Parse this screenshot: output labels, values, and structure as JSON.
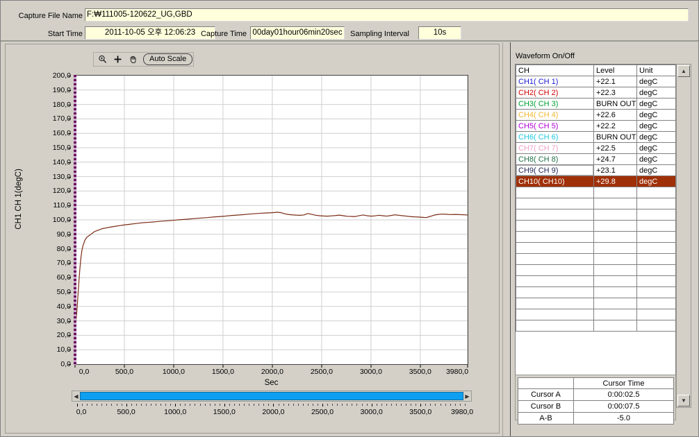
{
  "header": {
    "file_label": "Capture File Name",
    "file_value": "F:₩111005-120622_UG,GBD",
    "start_label": "Start Time",
    "start_value": "2011-10-05 오후 12:06:23",
    "capture_label": "Capture Time",
    "capture_value": "00day01hour06min20sec",
    "sampling_label": "Sampling Interval",
    "sampling_value": "10s"
  },
  "toolbar": {
    "zoom_icon": "magnifier-icon",
    "crosshair_icon": "crosshair-icon",
    "pan_icon": "hand-icon",
    "autoscale_label": "Auto Scale"
  },
  "right": {
    "waveform_title": "Waveform On/Off",
    "columns": [
      "CH",
      "Level",
      "Unit"
    ],
    "channels": [
      {
        "name": "CH1( CH 1)",
        "level": "+22.1",
        "unit": "degC",
        "color": "#1a1ad0",
        "selected": false,
        "focus": false
      },
      {
        "name": "CH2( CH 2)",
        "level": "+22.3",
        "unit": "degC",
        "color": "#d00000",
        "selected": false,
        "focus": false
      },
      {
        "name": "CH3( CH 3)",
        "level": "BURN OUT",
        "unit": "degC",
        "color": "#00a030",
        "selected": false,
        "focus": false
      },
      {
        "name": "CH4( CH 4)",
        "level": "+22.6",
        "unit": "degC",
        "color": "#f0b830",
        "selected": false,
        "focus": false
      },
      {
        "name": "CH5( CH 5)",
        "level": "+22.2",
        "unit": "degC",
        "color": "#b000d8",
        "selected": false,
        "focus": false
      },
      {
        "name": "CH6( CH 6)",
        "level": "BURN OUT",
        "unit": "degC",
        "color": "#20c8e0",
        "selected": false,
        "focus": false
      },
      {
        "name": "CH7( CH 7)",
        "level": "+22.5",
        "unit": "degC",
        "color": "#f0a0c8",
        "selected": false,
        "focus": false
      },
      {
        "name": "CH8( CH 8)",
        "level": "+24.7",
        "unit": "degC",
        "color": "#207048",
        "selected": false,
        "focus": false
      },
      {
        "name": "CH9( CH 9)",
        "level": "+23.1",
        "unit": "degC",
        "color": "#202858",
        "selected": false,
        "focus": true
      },
      {
        "name": "CH10( CH10)",
        "level": "+29.8",
        "unit": "degC",
        "color": "#ffffff",
        "selected": true,
        "focus": false
      }
    ],
    "empty_row_count": 13,
    "selection_color": "#a03008",
    "cursor": {
      "header": [
        "",
        "Cursor Time"
      ],
      "rows": [
        {
          "label": "Cursor A",
          "value": "0:00:02.5"
        },
        {
          "label": "Cursor B",
          "value": "0:00:07.5"
        },
        {
          "label": "A-B",
          "value": "-5.0"
        }
      ]
    }
  },
  "chart_data": {
    "type": "line",
    "title": "",
    "xlabel": "Sec",
    "ylabel": "CH1  CH 1(degC)",
    "xlim": [
      0,
      3980
    ],
    "ylim": [
      0,
      200
    ],
    "grid": true,
    "legend": "none",
    "x_ticks": [
      "0,0",
      "500,0",
      "1000,0",
      "1500,0",
      "2000,0",
      "2500,0",
      "3000,0",
      "3500,0",
      "3980,0"
    ],
    "x_tick_values": [
      0,
      500,
      1000,
      1500,
      2000,
      2500,
      3000,
      3500,
      3980
    ],
    "y_ticks": [
      "200,0",
      "190,0",
      "180,0",
      "170,0",
      "160,0",
      "150,0",
      "140,0",
      "130,0",
      "120,0",
      "110,0",
      "100,0",
      "90,0",
      "80,0",
      "70,0",
      "60,0",
      "50,0",
      "40,0",
      "30,0",
      "20,0",
      "10,0",
      "0,0"
    ],
    "y_tick_values": [
      200,
      190,
      180,
      170,
      160,
      150,
      140,
      130,
      120,
      110,
      100,
      90,
      80,
      70,
      60,
      50,
      40,
      30,
      20,
      10,
      0
    ],
    "series": [
      {
        "name": "CH1 CH 1",
        "color": "#7a2a14",
        "x": [
          0,
          10,
          20,
          30,
          40,
          50,
          60,
          70,
          80,
          90,
          100,
          120,
          140,
          160,
          180,
          200,
          240,
          280,
          320,
          360,
          400,
          450,
          500,
          560,
          620,
          680,
          740,
          800,
          860,
          920,
          980,
          1040,
          1100,
          1160,
          1220,
          1280,
          1340,
          1400,
          1460,
          1520,
          1580,
          1640,
          1700,
          1760,
          1820,
          1880,
          1940,
          2000,
          2050,
          2090,
          2120,
          2160,
          2200,
          2240,
          2280,
          2320,
          2360,
          2400,
          2440,
          2480,
          2520,
          2560,
          2600,
          2640,
          2680,
          2720,
          2760,
          2800,
          2840,
          2880,
          2920,
          2960,
          3000,
          3040,
          3080,
          3120,
          3160,
          3200,
          3240,
          3280,
          3320,
          3360,
          3400,
          3440,
          3480,
          3520,
          3560,
          3600,
          3640,
          3680,
          3720,
          3760,
          3800,
          3860,
          3920,
          3980
        ],
        "y": [
          25,
          30,
          38,
          48,
          58,
          67,
          74,
          79,
          82,
          84,
          86,
          88,
          89,
          90,
          91,
          92,
          93,
          94,
          94.5,
          95,
          95.5,
          96,
          96.5,
          97,
          97.5,
          98,
          98.3,
          98.6,
          99,
          99.3,
          99.6,
          100,
          100.3,
          100.6,
          101,
          101.3,
          101.6,
          102,
          102.3,
          102.6,
          103,
          103.3,
          103.6,
          104,
          104.3,
          104.6,
          104.8,
          105,
          105.3,
          105,
          104.3,
          103.8,
          103.5,
          103.3,
          103.2,
          103.4,
          104.4,
          103.8,
          103.2,
          102.9,
          102.7,
          102.6,
          102.8,
          103,
          103.3,
          102.9,
          102.5,
          102.4,
          102.3,
          102.9,
          103.4,
          102.9,
          102.6,
          102.8,
          103.2,
          102.9,
          102.6,
          103,
          103.5,
          103.2,
          102.9,
          102.6,
          102.3,
          102.1,
          102,
          101.8,
          101.6,
          102.4,
          103.3,
          103.8,
          104,
          103.9,
          103.7,
          103.8,
          103.6,
          103.4,
          103.5
        ]
      }
    ]
  },
  "scrollbar": {
    "thumb_color": "#0f9ff0",
    "left_arrow": "◀",
    "right_arrow": "▶"
  },
  "ruler": {
    "labels": [
      "0,0",
      "500,0",
      "1000,0",
      "1500,0",
      "2000,0",
      "2500,0",
      "3000,0",
      "3500,0",
      "3980,0"
    ],
    "values": [
      0,
      500,
      1000,
      1500,
      2000,
      2500,
      3000,
      3500,
      3980
    ]
  }
}
